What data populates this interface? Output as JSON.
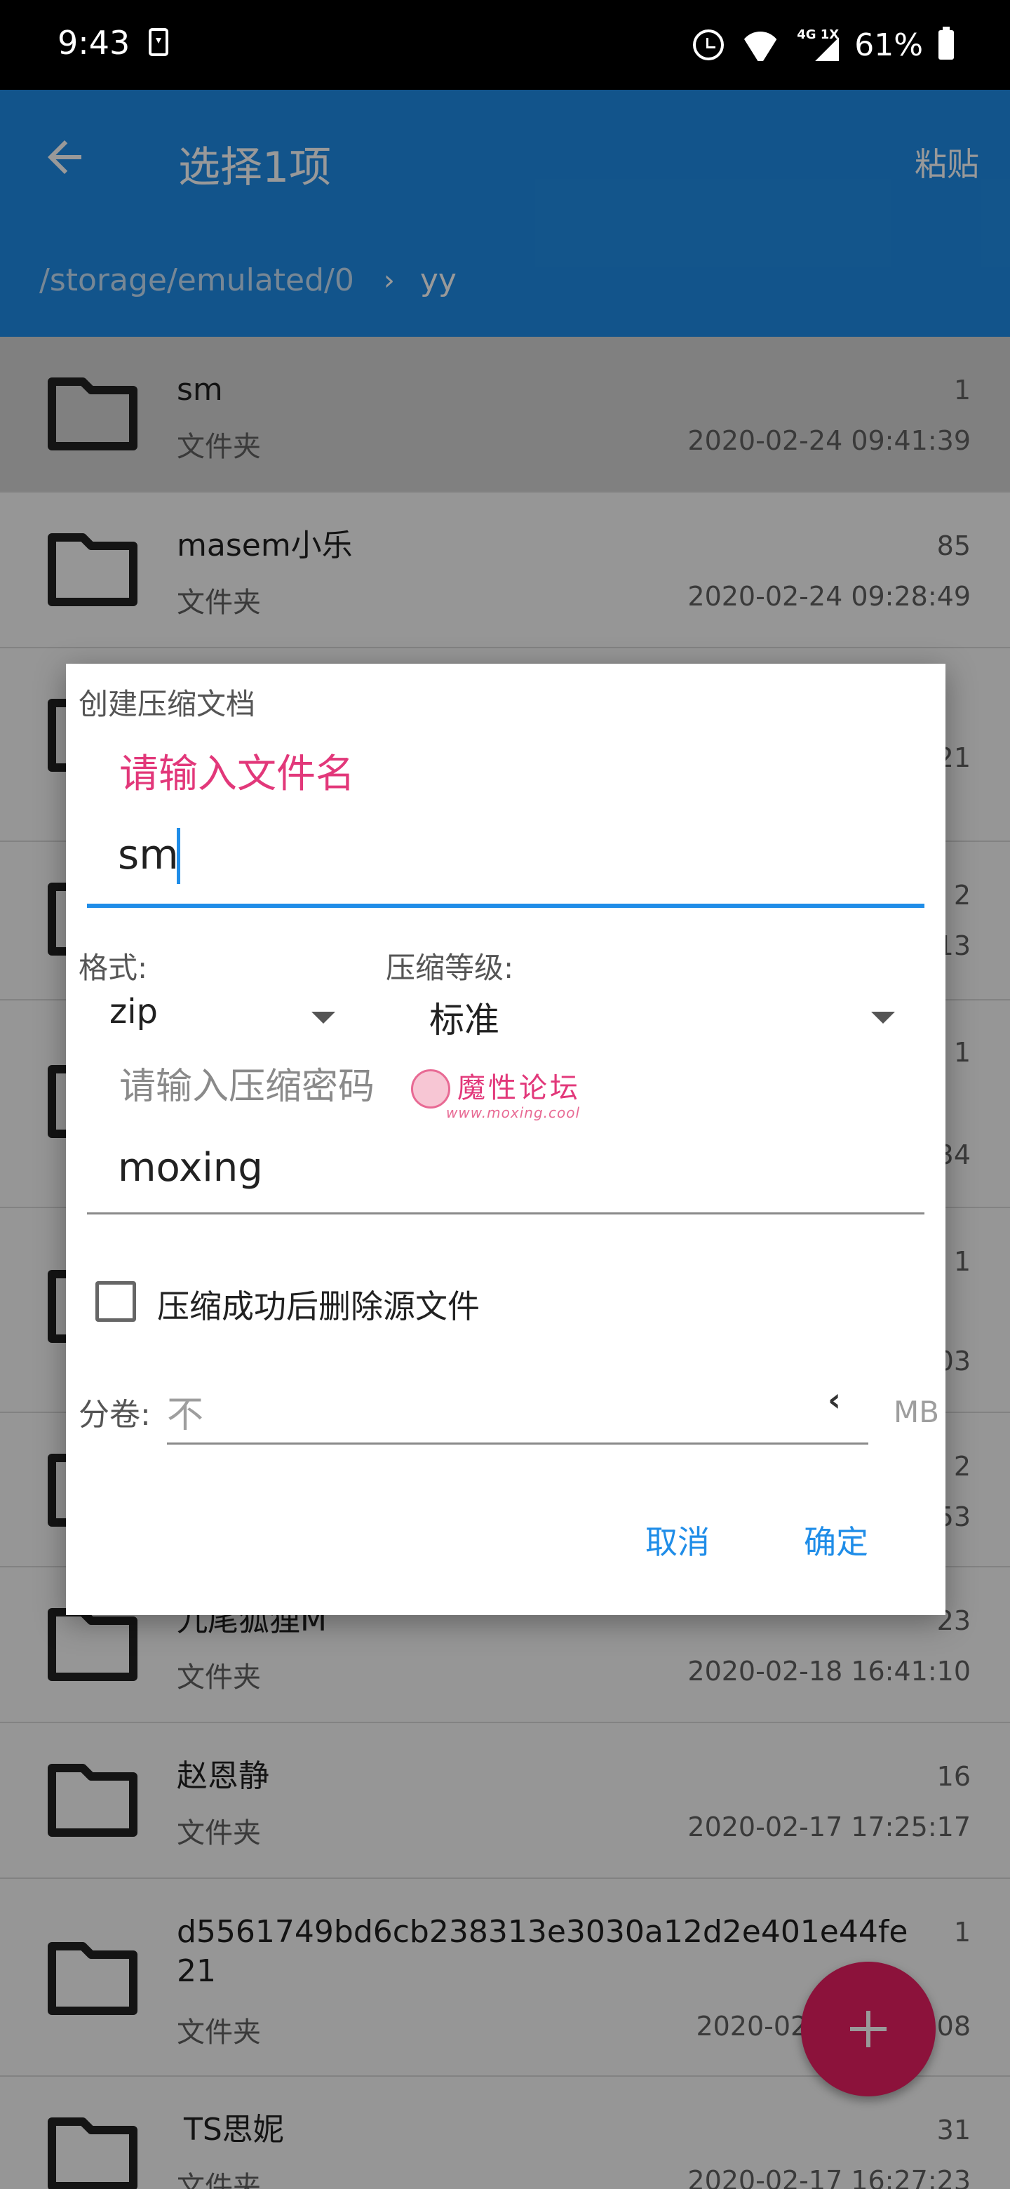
{
  "status_bar": {
    "time": "9:43",
    "network_label": "4G 1X",
    "battery": "61%"
  },
  "app_bar": {
    "title": "选择1项",
    "action_paste": "粘贴",
    "breadcrumb_root": "/storage/emulated/0",
    "breadcrumb_current": "yy"
  },
  "file_list": [
    {
      "name": "sm",
      "kind": "文件夹",
      "count": "1",
      "date": "2020-02-24 09:41:39",
      "selected": true
    },
    {
      "name": "masem小乐",
      "kind": "文件夹",
      "count": "85",
      "date": "2020-02-24 09:28:49"
    },
    {
      "name": "",
      "kind": "",
      "count": "21",
      "date": ""
    },
    {
      "name": "",
      "kind": "",
      "count": "2",
      "date": "13"
    },
    {
      "name": "",
      "kind": "",
      "count": "1",
      "date": "34"
    },
    {
      "name": "",
      "kind": "",
      "count": "1",
      "date": "03"
    },
    {
      "name": "",
      "kind": "",
      "count": "2",
      "date": "53"
    },
    {
      "name": "九尾狐狸M",
      "kind": "文件夹",
      "count": "23",
      "date": "2020-02-18 16:41:10"
    },
    {
      "name": "赵恩静",
      "kind": "文件夹",
      "count": "16",
      "date": "2020-02-17 17:25:17"
    },
    {
      "name": "d5561749bd6cb238313e3030a12d2e401e44fe21",
      "kind": "文件夹",
      "count": "1",
      "date": "2020-02-17 1?:??:08"
    },
    {
      "name": "TS思妮",
      "kind": "文件夹",
      "count": "31",
      "date": "2020-02-17 16:27:23"
    }
  ],
  "dialog": {
    "title": "创建压缩文档",
    "filename_hint": "请输入文件名",
    "filename_value": "sm",
    "format_label": "格式:",
    "format_value": "zip",
    "level_label": "压缩等级:",
    "level_value": "标准",
    "password_hint": "请输入压缩密码",
    "password_value": "moxing",
    "delete_source_label": "压缩成功后删除源文件",
    "delete_source_checked": false,
    "volume_label": "分卷:",
    "volume_value": "不",
    "volume_unit": "MB",
    "cancel": "取消",
    "ok": "确定"
  },
  "watermark": {
    "title": "魔性论坛",
    "url": "www.moxing.cool"
  },
  "colors": {
    "primary": "#1f8de8",
    "accent": "#e91e63",
    "hint_pink": "#e2387a"
  }
}
